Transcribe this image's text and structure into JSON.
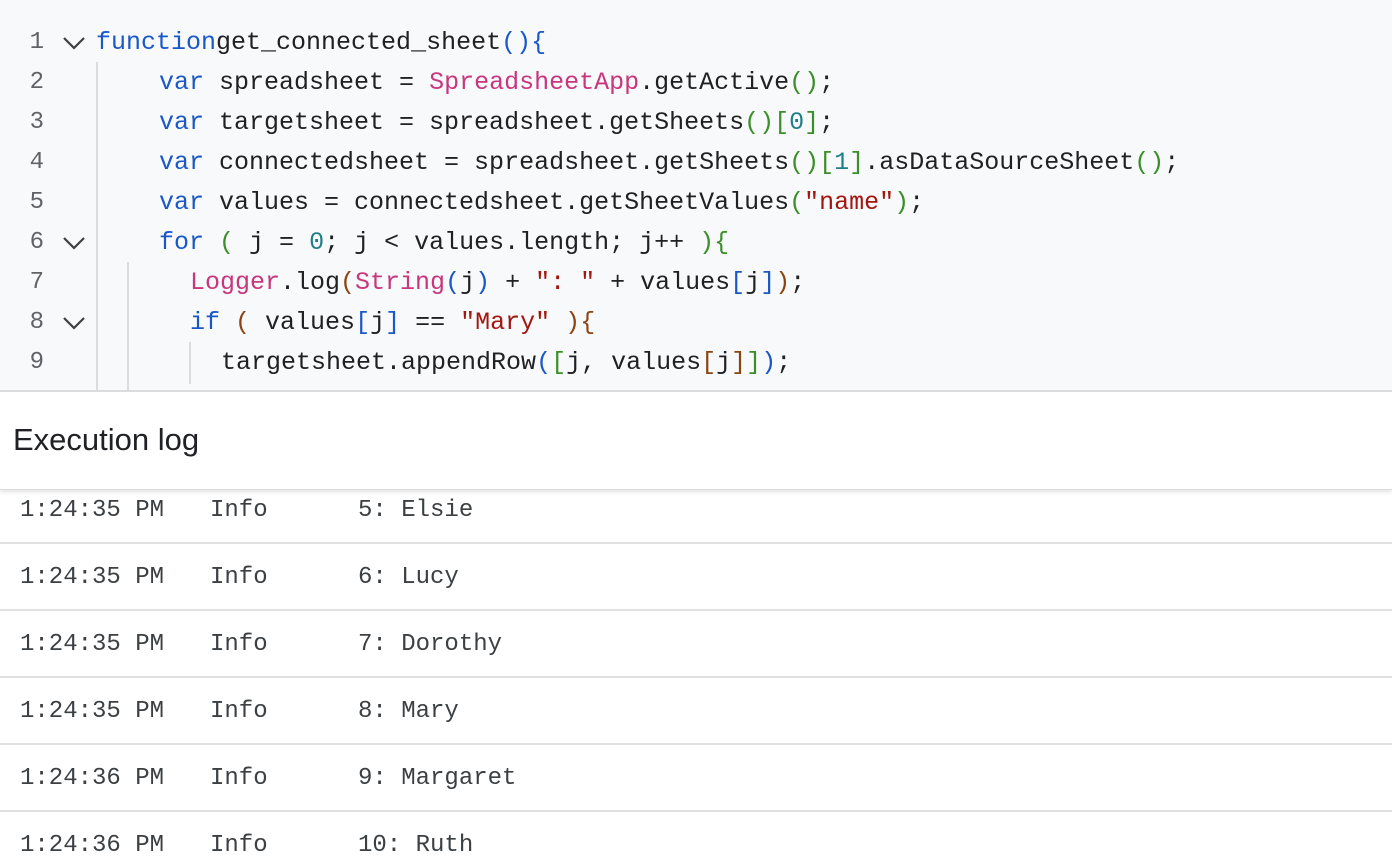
{
  "editor": {
    "line_numbers": [
      "1",
      "2",
      "3",
      "4",
      "5",
      "6",
      "7",
      "8",
      "9"
    ],
    "lines": [
      [
        [
          "kw",
          "function"
        ],
        [
          "",
          "get_connected_sheet"
        ],
        [
          "p1",
          "()"
        ],
        [
          "",
          ""
        ],
        [
          "p1",
          "{"
        ]
      ],
      [
        [
          "kw",
          "var"
        ],
        [
          "",
          " spreadsheet = "
        ],
        [
          "cls",
          "SpreadsheetApp"
        ],
        [
          "",
          ".getActive"
        ],
        [
          "p2",
          "()"
        ],
        [
          "",
          ";"
        ]
      ],
      [
        [
          "kw",
          "var"
        ],
        [
          "",
          " targetsheet = spreadsheet.getSheets"
        ],
        [
          "p2",
          "()"
        ],
        [
          "p2",
          "["
        ],
        [
          "num",
          "0"
        ],
        [
          "p2",
          "]"
        ],
        [
          "",
          ";"
        ]
      ],
      [
        [
          "kw",
          "var"
        ],
        [
          "",
          " connectedsheet = spreadsheet.getSheets"
        ],
        [
          "p2",
          "()"
        ],
        [
          "p2",
          "["
        ],
        [
          "num",
          "1"
        ],
        [
          "p2",
          "]"
        ],
        [
          "",
          ".asDataSourceSheet"
        ],
        [
          "p2",
          "()"
        ],
        [
          "",
          ";"
        ]
      ],
      [
        [
          "kw",
          "var"
        ],
        [
          "",
          " values = connectedsheet.getSheetValues"
        ],
        [
          "p2",
          "("
        ],
        [
          "str",
          "\"name\""
        ],
        [
          "p2",
          ")"
        ],
        [
          "",
          ";"
        ]
      ],
      [
        [
          "kw",
          "for"
        ],
        [
          "",
          " "
        ],
        [
          "p2",
          "("
        ],
        [
          "",
          " j = "
        ],
        [
          "num",
          "0"
        ],
        [
          "",
          "; j < values.length; j++ "
        ],
        [
          "p2",
          ")"
        ],
        [
          "p2",
          "{"
        ]
      ],
      [
        [
          "cls",
          "Logger"
        ],
        [
          "",
          ".log"
        ],
        [
          "p3",
          "("
        ],
        [
          "cls",
          "String"
        ],
        [
          "p1",
          "("
        ],
        [
          "",
          "j"
        ],
        [
          "p1",
          ")"
        ],
        [
          "",
          " + "
        ],
        [
          "str",
          "\": \""
        ],
        [
          "",
          " + values"
        ],
        [
          "p1",
          "["
        ],
        [
          "",
          "j"
        ],
        [
          "p1",
          "]"
        ],
        [
          "p3",
          ")"
        ],
        [
          "",
          ";"
        ]
      ],
      [
        [
          "kw",
          "if"
        ],
        [
          "",
          " "
        ],
        [
          "p3",
          "("
        ],
        [
          "",
          " values"
        ],
        [
          "p1",
          "["
        ],
        [
          "",
          "j"
        ],
        [
          "p1",
          "]"
        ],
        [
          "",
          " == "
        ],
        [
          "str",
          "\"Mary\""
        ],
        [
          "",
          " "
        ],
        [
          "p3",
          ")"
        ],
        [
          "p3",
          "{"
        ]
      ],
      [
        [
          "",
          "targetsheet.appendRow"
        ],
        [
          "p1",
          "("
        ],
        [
          "p2",
          "["
        ],
        [
          "",
          "j, values"
        ],
        [
          "p3",
          "["
        ],
        [
          "",
          "j"
        ],
        [
          "p3",
          "]"
        ],
        [
          "p2",
          "]"
        ],
        [
          "p1",
          ")"
        ],
        [
          "",
          ";"
        ]
      ]
    ],
    "folds": [
      true,
      false,
      false,
      false,
      false,
      true,
      false,
      true,
      false
    ]
  },
  "log": {
    "title": "Execution log",
    "rows": [
      {
        "time": "1:24:35 PM",
        "level": "Info",
        "message": "5: Elsie"
      },
      {
        "time": "1:24:35 PM",
        "level": "Info",
        "message": "6: Lucy"
      },
      {
        "time": "1:24:35 PM",
        "level": "Info",
        "message": "7: Dorothy"
      },
      {
        "time": "1:24:35 PM",
        "level": "Info",
        "message": "8: Mary"
      },
      {
        "time": "1:24:36 PM",
        "level": "Info",
        "message": "9: Margaret"
      },
      {
        "time": "1:24:36 PM",
        "level": "Info",
        "message": "10: Ruth"
      }
    ]
  }
}
